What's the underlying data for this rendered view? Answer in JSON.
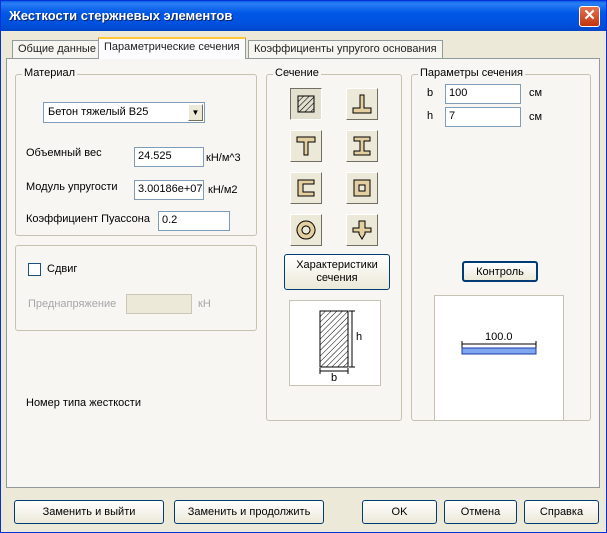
{
  "window": {
    "title": "Жесткости стержневых элементов",
    "close_symbol": "✕"
  },
  "tabs": [
    {
      "label": "Общие данные"
    },
    {
      "label": "Параметрические сечения"
    },
    {
      "label": "Коэффициенты упругого основания"
    }
  ],
  "material": {
    "legend": "Материал",
    "selected": "Бетон тяжелый B25",
    "weight_label": "Объемный вес",
    "weight_value": "24.525",
    "weight_unit": "кН/м^3",
    "modulus_label": "Модуль упругости",
    "modulus_value": "3.00186e+07",
    "modulus_unit": "кН/м2",
    "poisson_label": "Коэффициент Пуассона",
    "poisson_value": "0.2"
  },
  "shear": {
    "checkbox_label": "Сдвиг",
    "prestress_label": "Преднапряжение",
    "prestress_value": "",
    "prestress_unit": "кН"
  },
  "stiffness_type_label": "Номер типа жесткости",
  "section": {
    "legend": "Сечение",
    "shapes": [
      "rectangle-icon",
      "inverted-t-icon",
      "t-section-icon",
      "i-beam-icon",
      "channel-icon",
      "box-section-icon",
      "ring-icon",
      "cross-section-icon"
    ],
    "props_button": "Характеристики сечения",
    "preview_labels": {
      "h": "h",
      "b": "b"
    }
  },
  "params": {
    "legend": "Параметры сечения",
    "b_label": "b",
    "b_value": "100",
    "b_unit": "см",
    "h_label": "h",
    "h_value": "7",
    "h_unit": "см",
    "check_button": "Контроль",
    "check_dimension": "100.0"
  },
  "footer": {
    "replace_exit": "Заменить и выйти",
    "replace_continue": "Заменить и продолжить",
    "ok": "OK",
    "cancel": "Отмена",
    "help": "Справка"
  }
}
